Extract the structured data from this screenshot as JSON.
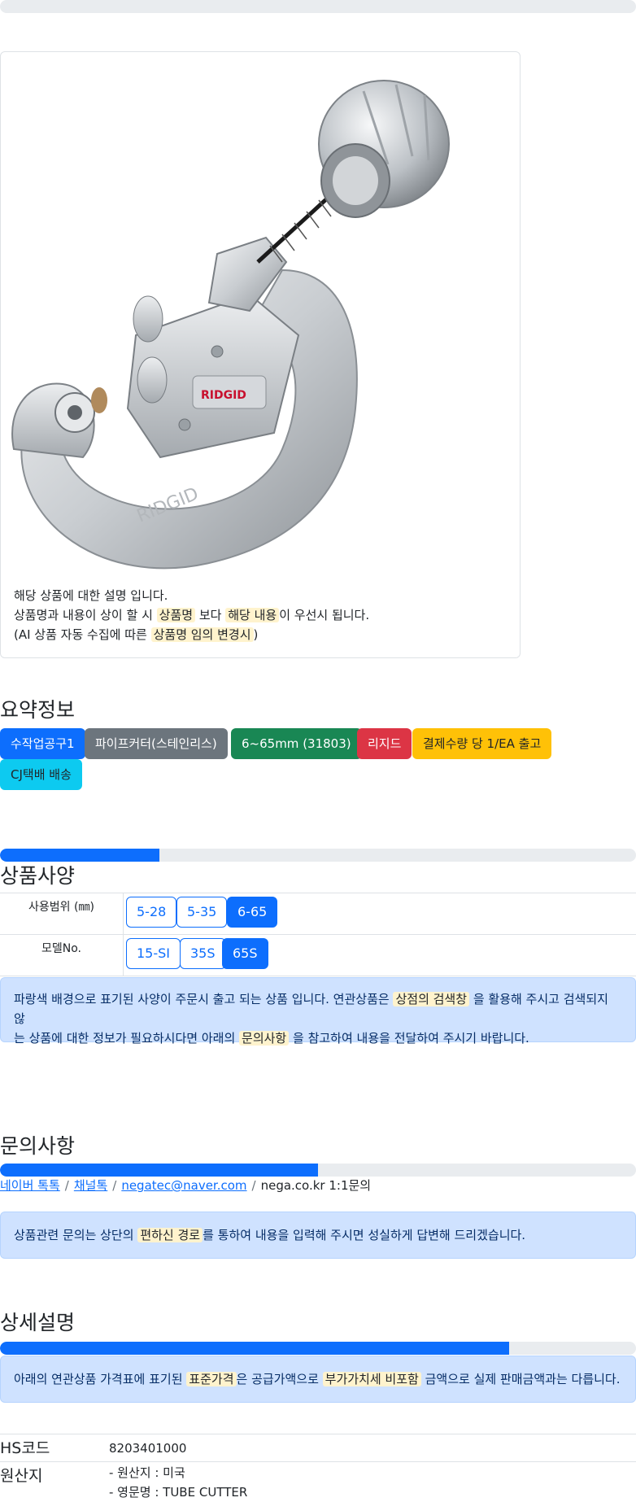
{
  "card": {
    "line1": "해당 상품에 대한 설명 입니다.",
    "line2_a": "상품명과 내용이 상이 할 시",
    "line2_hl1": "상품명",
    "line2_b": "보다",
    "line2_hl2": "해당 내용",
    "line2_c": "이 우선시 됩니다.",
    "line3_a": "(AI 상품 자동 수집에 따른",
    "line3_hl": "상품명 임의 변경시",
    "line3_b": ")"
  },
  "summary": {
    "title": "요약정보",
    "badges": [
      {
        "label": "수작업공구1",
        "color": "#0d6efd",
        "text": "#ffffff"
      },
      {
        "label": "파이프커터(스테인리스)",
        "color": "#6c757d",
        "text": "#ffffff"
      },
      {
        "label": "6~65mm (31803)",
        "color": "#198754",
        "text": "#ffffff"
      },
      {
        "label": "리지드",
        "color": "#dc3545",
        "text": "#ffffff"
      },
      {
        "label": "결제수량 당 1/EA 출고",
        "color": "#ffc107",
        "text": "#212529"
      },
      {
        "label": "CJ택배 배송",
        "color": "#0dcaf0",
        "text": "#212529"
      }
    ]
  },
  "specs": {
    "title": "상품사양",
    "progress": 0.25,
    "rows": [
      {
        "label": "사용범위 (㎜)",
        "options": [
          "5-28",
          "5-35",
          "6-65"
        ],
        "active": 2
      },
      {
        "label": "모델No.",
        "options": [
          "15-SI",
          "35S",
          "65S"
        ],
        "active": 2
      }
    ],
    "note_a": "파랑색 배경으로 표기된 사양이 주문시 출고 되는 상품 입니다. 연관상품은",
    "note_hl1": "상점의 검색창",
    "note_b": "을 활용해 주시고 검색되지 않",
    "note_c": "는 상품에 대한 정보가 필요하시다면 아래의",
    "note_hl2": "문의사항",
    "note_d": "을 참고하여 내용을 전달하여 주시기 바랍니다."
  },
  "inquiry": {
    "title": "문의사항",
    "progress": 0.5,
    "links": [
      "네이버 톡톡",
      "채널톡",
      "negatec@naver.com"
    ],
    "plain": "nega.co.kr 1:1문의",
    "note_a": "상품관련 문의는 상단의",
    "note_hl": "편하신 경로",
    "note_b": "를 통하여 내용을 입력해 주시면 성실하게 답변해 드리겠습니다."
  },
  "detail": {
    "title": "상세설명",
    "progress": 0.8,
    "note_a": "아래의 연관상품 가격표에 표기된",
    "note_hl1": "표준가격",
    "note_b": "은 공급가액으로",
    "note_hl2": "부가가치세 비포함",
    "note_c": "금액으로 실제 판매금액과는 다릅니다.",
    "hs_label": "HS코드",
    "hs_value": "8203401000",
    "origin_label": "원산지",
    "origin_line1": "- 원산지 : 미국",
    "origin_line2": "- 영문명 : TUBE CUTTER"
  }
}
